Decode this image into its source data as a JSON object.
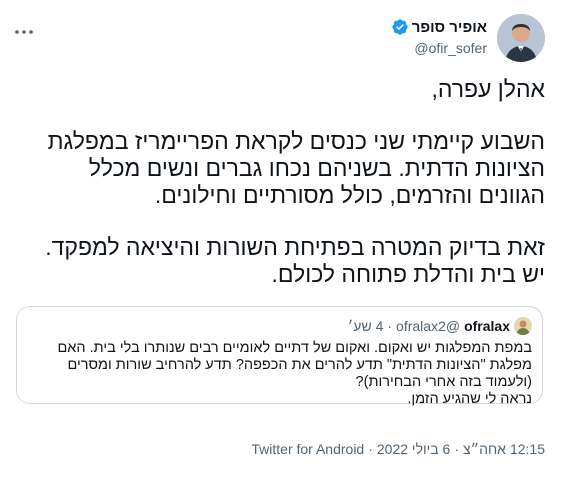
{
  "author": {
    "display_name": "אופיר סופר",
    "handle": "@ofir_sofer",
    "verified": true
  },
  "more_icon": "ellipsis-icon",
  "tweet": {
    "lines": [
      "אהלן עפרה,",
      "השבוע קיימתי שני כנסים לקראת הפריימריז במפלגת",
      "הציונות הדתית. בשניהם נכחו גברים ונשים מכלל",
      "הגוונים והזרמים, כולל מסורתיים וחילונים.",
      "זאת בדיוק המטרה בפתיחת השורות והיציאה למפקד.",
      "יש בית והדלת פתוחה לכולם."
    ]
  },
  "quote": {
    "display_name": "ofralax",
    "handle": "@ofralax2",
    "separator": "·",
    "time": "4 שע׳",
    "lines": [
      "במפת המפלגות יש ואקום. ואקום של דתיים לאומיים רבים שנותרו בלי בית. האם",
      "מפלגת \"הציונות הדתית\" תדע להרים את הכפפה? תדע להרחיב שורות ומסרים",
      "(ולעמוד בזה אחרי הבחירות)?",
      "נראה לי שהגיע הזמן."
    ]
  },
  "meta": {
    "time": "12:15",
    "am_pm": "אחה״צ",
    "dot1": "·",
    "date": "6 ביולי 2022",
    "dot2": "·",
    "source": "Twitter for Android"
  },
  "colors": {
    "text": "#0f1419",
    "secondary": "#536471",
    "verified_badge": "#1d9bf0",
    "border": "#cfd9de"
  }
}
